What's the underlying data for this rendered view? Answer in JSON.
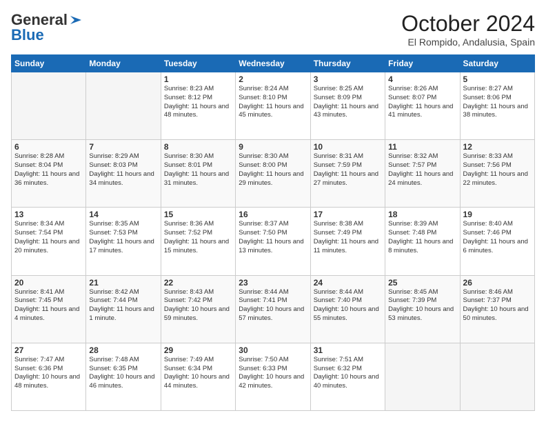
{
  "header": {
    "logo_line1": "General",
    "logo_line2": "Blue",
    "month": "October 2024",
    "location": "El Rompido, Andalusia, Spain"
  },
  "weekdays": [
    "Sunday",
    "Monday",
    "Tuesday",
    "Wednesday",
    "Thursday",
    "Friday",
    "Saturday"
  ],
  "weeks": [
    [
      {
        "day": "",
        "info": ""
      },
      {
        "day": "",
        "info": ""
      },
      {
        "day": "1",
        "info": "Sunrise: 8:23 AM\nSunset: 8:12 PM\nDaylight: 11 hours and 48 minutes."
      },
      {
        "day": "2",
        "info": "Sunrise: 8:24 AM\nSunset: 8:10 PM\nDaylight: 11 hours and 45 minutes."
      },
      {
        "day": "3",
        "info": "Sunrise: 8:25 AM\nSunset: 8:09 PM\nDaylight: 11 hours and 43 minutes."
      },
      {
        "day": "4",
        "info": "Sunrise: 8:26 AM\nSunset: 8:07 PM\nDaylight: 11 hours and 41 minutes."
      },
      {
        "day": "5",
        "info": "Sunrise: 8:27 AM\nSunset: 8:06 PM\nDaylight: 11 hours and 38 minutes."
      }
    ],
    [
      {
        "day": "6",
        "info": "Sunrise: 8:28 AM\nSunset: 8:04 PM\nDaylight: 11 hours and 36 minutes."
      },
      {
        "day": "7",
        "info": "Sunrise: 8:29 AM\nSunset: 8:03 PM\nDaylight: 11 hours and 34 minutes."
      },
      {
        "day": "8",
        "info": "Sunrise: 8:30 AM\nSunset: 8:01 PM\nDaylight: 11 hours and 31 minutes."
      },
      {
        "day": "9",
        "info": "Sunrise: 8:30 AM\nSunset: 8:00 PM\nDaylight: 11 hours and 29 minutes."
      },
      {
        "day": "10",
        "info": "Sunrise: 8:31 AM\nSunset: 7:59 PM\nDaylight: 11 hours and 27 minutes."
      },
      {
        "day": "11",
        "info": "Sunrise: 8:32 AM\nSunset: 7:57 PM\nDaylight: 11 hours and 24 minutes."
      },
      {
        "day": "12",
        "info": "Sunrise: 8:33 AM\nSunset: 7:56 PM\nDaylight: 11 hours and 22 minutes."
      }
    ],
    [
      {
        "day": "13",
        "info": "Sunrise: 8:34 AM\nSunset: 7:54 PM\nDaylight: 11 hours and 20 minutes."
      },
      {
        "day": "14",
        "info": "Sunrise: 8:35 AM\nSunset: 7:53 PM\nDaylight: 11 hours and 17 minutes."
      },
      {
        "day": "15",
        "info": "Sunrise: 8:36 AM\nSunset: 7:52 PM\nDaylight: 11 hours and 15 minutes."
      },
      {
        "day": "16",
        "info": "Sunrise: 8:37 AM\nSunset: 7:50 PM\nDaylight: 11 hours and 13 minutes."
      },
      {
        "day": "17",
        "info": "Sunrise: 8:38 AM\nSunset: 7:49 PM\nDaylight: 11 hours and 11 minutes."
      },
      {
        "day": "18",
        "info": "Sunrise: 8:39 AM\nSunset: 7:48 PM\nDaylight: 11 hours and 8 minutes."
      },
      {
        "day": "19",
        "info": "Sunrise: 8:40 AM\nSunset: 7:46 PM\nDaylight: 11 hours and 6 minutes."
      }
    ],
    [
      {
        "day": "20",
        "info": "Sunrise: 8:41 AM\nSunset: 7:45 PM\nDaylight: 11 hours and 4 minutes."
      },
      {
        "day": "21",
        "info": "Sunrise: 8:42 AM\nSunset: 7:44 PM\nDaylight: 11 hours and 1 minute."
      },
      {
        "day": "22",
        "info": "Sunrise: 8:43 AM\nSunset: 7:42 PM\nDaylight: 10 hours and 59 minutes."
      },
      {
        "day": "23",
        "info": "Sunrise: 8:44 AM\nSunset: 7:41 PM\nDaylight: 10 hours and 57 minutes."
      },
      {
        "day": "24",
        "info": "Sunrise: 8:44 AM\nSunset: 7:40 PM\nDaylight: 10 hours and 55 minutes."
      },
      {
        "day": "25",
        "info": "Sunrise: 8:45 AM\nSunset: 7:39 PM\nDaylight: 10 hours and 53 minutes."
      },
      {
        "day": "26",
        "info": "Sunrise: 8:46 AM\nSunset: 7:37 PM\nDaylight: 10 hours and 50 minutes."
      }
    ],
    [
      {
        "day": "27",
        "info": "Sunrise: 7:47 AM\nSunset: 6:36 PM\nDaylight: 10 hours and 48 minutes."
      },
      {
        "day": "28",
        "info": "Sunrise: 7:48 AM\nSunset: 6:35 PM\nDaylight: 10 hours and 46 minutes."
      },
      {
        "day": "29",
        "info": "Sunrise: 7:49 AM\nSunset: 6:34 PM\nDaylight: 10 hours and 44 minutes."
      },
      {
        "day": "30",
        "info": "Sunrise: 7:50 AM\nSunset: 6:33 PM\nDaylight: 10 hours and 42 minutes."
      },
      {
        "day": "31",
        "info": "Sunrise: 7:51 AM\nSunset: 6:32 PM\nDaylight: 10 hours and 40 minutes."
      },
      {
        "day": "",
        "info": ""
      },
      {
        "day": "",
        "info": ""
      }
    ]
  ]
}
